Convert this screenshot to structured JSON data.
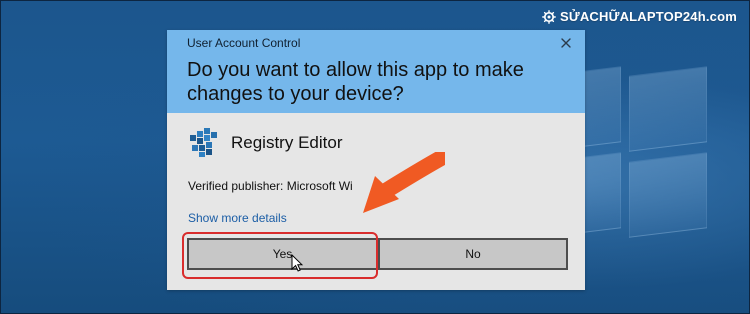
{
  "watermark": {
    "brand_text": "SỬACHỮALAPTOP24h.com"
  },
  "dialog": {
    "title": "User Account Control",
    "question": "Do you want to allow this app to make\nchanges to your device?",
    "app_name": "Registry Editor",
    "publisher": "Verified publisher: Microsoft Wi",
    "details_link": "Show more details",
    "buttons": {
      "yes": "Yes",
      "no": "No"
    }
  },
  "colors": {
    "header": "#75b7eb",
    "dialog_body": "#e6e6e6",
    "button_fill": "#c7c7c7",
    "accent_red": "#d92d2d",
    "arrow_orange": "#f05a23"
  },
  "icons": {
    "brand": "gear-icon",
    "close": "close-icon",
    "app": "registry-editor-icon",
    "annotation_arrow": "arrow-icon",
    "cursor": "mouse-cursor-icon"
  }
}
